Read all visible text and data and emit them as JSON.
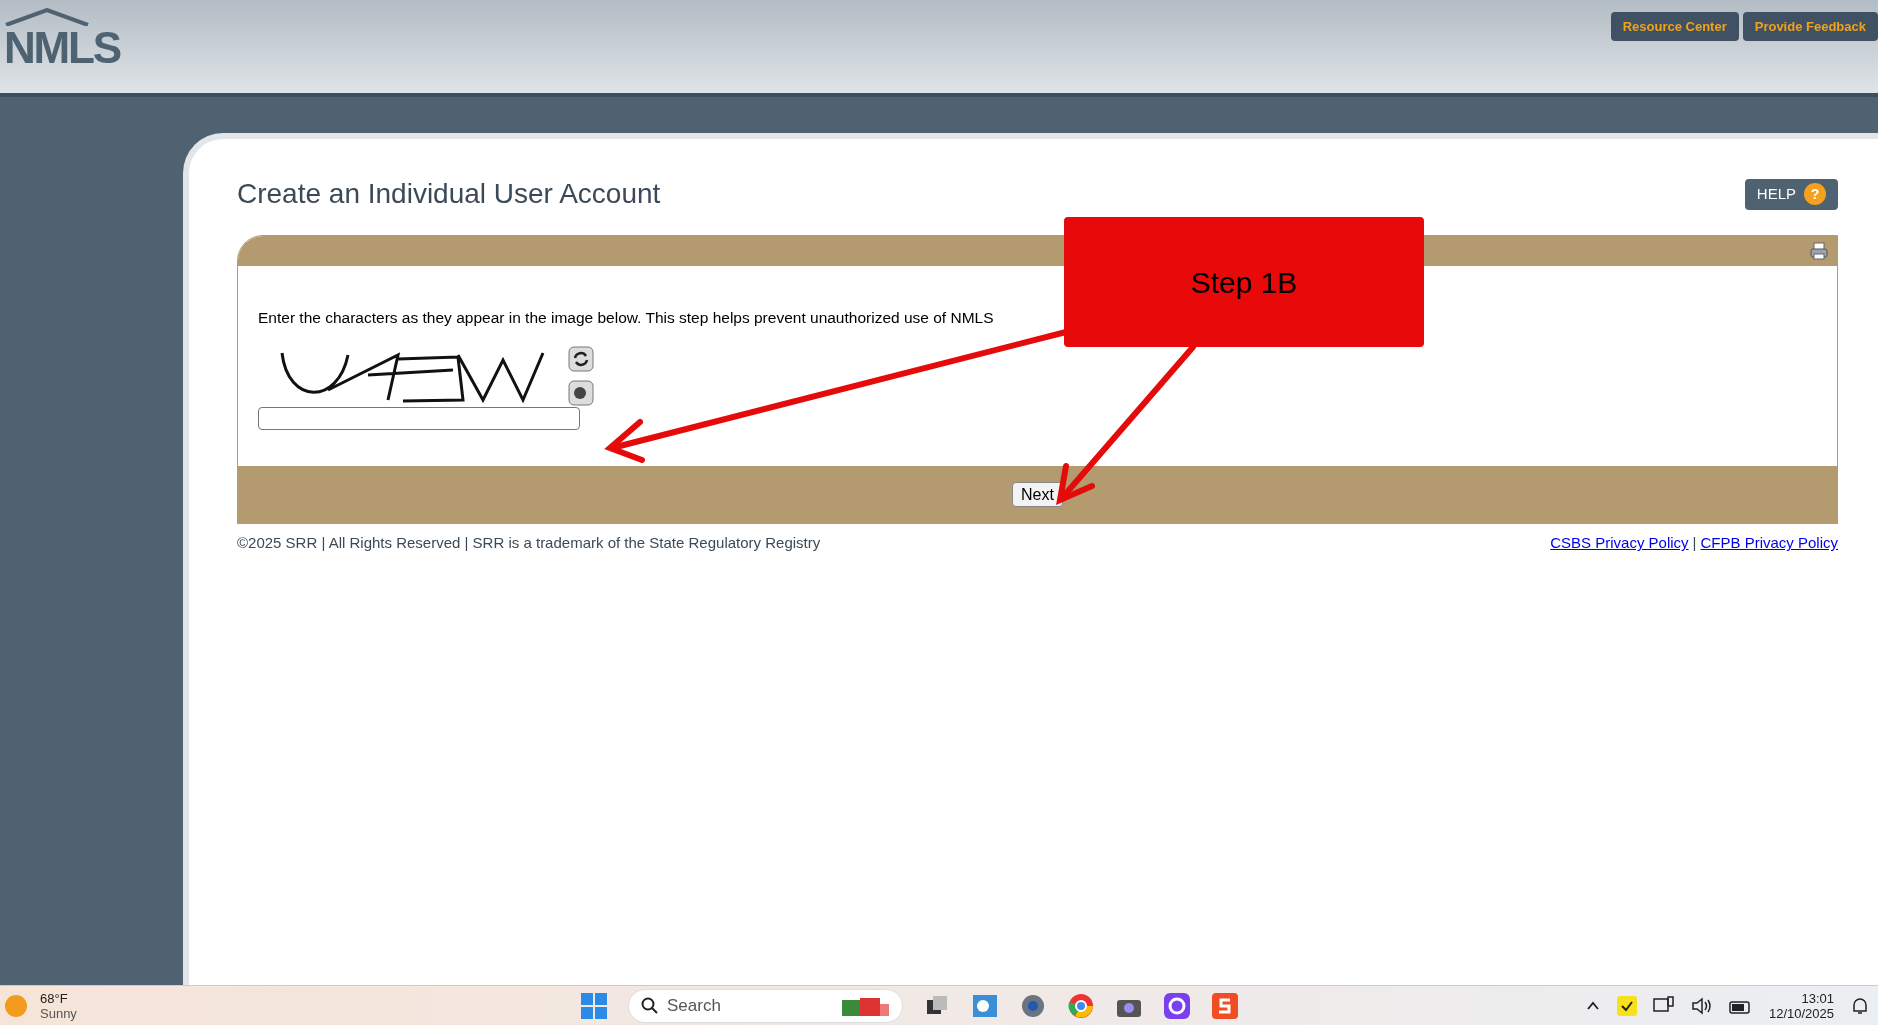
{
  "header": {
    "logo": "NMLS",
    "buttons": [
      "Resource Center",
      "Provide Feedback"
    ]
  },
  "page": {
    "title": "Create an Individual User Account",
    "help_button": "HELP",
    "help_icon": "?"
  },
  "form": {
    "instruction": "Enter the characters as they appear in the image below. This step helps prevent unauthorized use of NMLS",
    "next_button": "Next"
  },
  "footer": {
    "copyright": "©2025 SRR | All Rights Reserved | SRR is a trademark of the State Regulatory Registry",
    "links": [
      "CSBS Privacy Policy",
      "CFPB Privacy Policy"
    ],
    "separator": "|"
  },
  "annotation": {
    "label": "Step 1B"
  },
  "taskbar": {
    "temperature": "68°F",
    "condition": "Sunny",
    "search_placeholder": "Search",
    "time": "13:01",
    "date": "12/10/2025"
  }
}
